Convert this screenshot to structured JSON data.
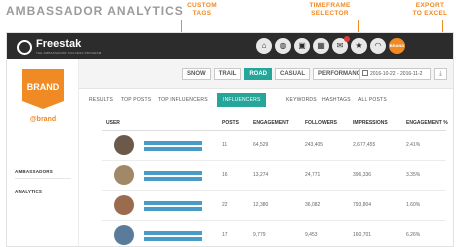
{
  "page": {
    "title": "AMBASSADOR ANALYTICS"
  },
  "callouts": {
    "custom_tags": [
      "CUSTOM",
      "TAGS"
    ],
    "timeframe": [
      "TIMEFRAME",
      "SELECTOR"
    ],
    "export": [
      "EXPORT",
      "TO EXCEL"
    ]
  },
  "header": {
    "logo_text": "Freestak",
    "logo_subtext": "THE AMBASSADOR SUCCESS PROGRAM",
    "nav_icons": [
      "home-icon",
      "dashboard-icon",
      "shop-icon",
      "analytics-icon",
      "messages-icon",
      "star-icon",
      "feed-icon",
      "brand-icon"
    ],
    "brand_icon_label": "BRAND"
  },
  "sidebar": {
    "brand_badge": "BRAND",
    "handle": "@brand",
    "items": [
      "AMBASSADORS",
      "ANALYTICS"
    ]
  },
  "filters": {
    "tags": [
      {
        "label": "SNOW",
        "active": false
      },
      {
        "label": "TRAIL",
        "active": false
      },
      {
        "label": "ROAD",
        "active": true
      },
      {
        "label": "CASUAL",
        "active": false
      },
      {
        "label": "PERFORMANCE",
        "active": false
      }
    ],
    "timeframe": "2016-10-22 - 2016-11-2",
    "export_icon": "download-icon"
  },
  "tabs": [
    {
      "label": "RESULTS",
      "active": false
    },
    {
      "label": "TOP POSTS",
      "active": false
    },
    {
      "label": "TOP INFLUENCERS",
      "active": false
    },
    {
      "label": "INFLUENCERS",
      "active": true
    },
    {
      "label": "KEYWORDS",
      "active": false
    },
    {
      "label": "HASHTAGS",
      "active": false
    },
    {
      "label": "ALL POSTS",
      "active": false
    }
  ],
  "table": {
    "columns": [
      "USER",
      "POSTS",
      "ENGAGEMENT",
      "FOLLOWERS",
      "IMPRESSIONS",
      "ENGAGEMENT %"
    ],
    "rows": [
      {
        "posts": "11",
        "engagement": "64,529",
        "followers": "243,405",
        "impressions": "2,677,455",
        "engagement_pct": "2.41%"
      },
      {
        "posts": "16",
        "engagement": "13,274",
        "followers": "24,771",
        "impressions": "396,336",
        "engagement_pct": "3.35%"
      },
      {
        "posts": "22",
        "engagement": "12,380",
        "followers": "36,082",
        "impressions": "793,804",
        "engagement_pct": "1.60%"
      },
      {
        "posts": "17",
        "engagement": "9,779",
        "followers": "9,453",
        "impressions": "160,701",
        "engagement_pct": "6.26%"
      }
    ]
  },
  "colors": {
    "accent": "#f08a24",
    "teal": "#26a69a",
    "topbar": "#2c2c2c",
    "name_placeholder": "#4a9cc8"
  }
}
